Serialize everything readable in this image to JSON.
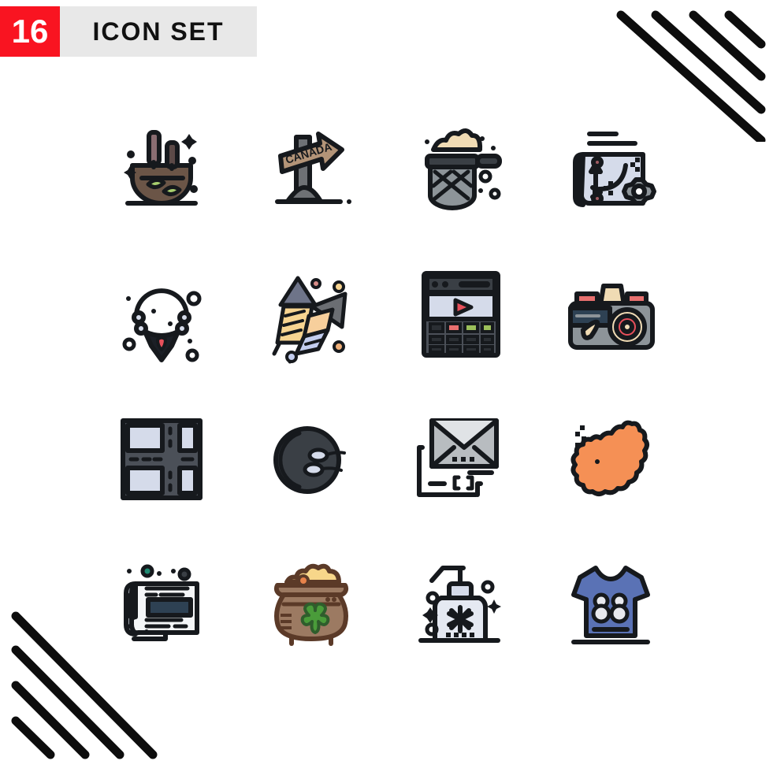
{
  "header": {
    "count": "16",
    "title": "ICON SET",
    "badge_color": "#f91421",
    "bar_color": "#e8e8e8",
    "title_color": "#111111"
  },
  "decor": {
    "top_right": {
      "name": "diagonal-stripes",
      "line_count": 4,
      "color": "#0d0d0d"
    },
    "bottom_left": {
      "name": "diagonal-stripes",
      "line_count": 4,
      "color": "#0d0d0d"
    }
  },
  "palette": {
    "outline": "#16191d",
    "brown": "#9c7a62",
    "brown_dark": "#6b5547",
    "green": "#8bc34a",
    "gray_blue": "#d5dbea",
    "gray": "#8d9499",
    "red": "#e8505b",
    "orange": "#f59055",
    "cream": "#f7e3b0",
    "blue": "#5a72b5",
    "dark": "#3a3f45"
  },
  "grid": {
    "columns": 4,
    "rows": 4,
    "total": 16
  },
  "icons": [
    {
      "index": 1,
      "name": "aroma-diffuser-icon",
      "label": "Aroma Diffuser",
      "row": 1,
      "col": 1
    },
    {
      "index": 2,
      "name": "canada-signpost-icon",
      "label": "Canada Signpost",
      "row": 1,
      "col": 2,
      "text": "CANADA"
    },
    {
      "index": 3,
      "name": "strainer-icon",
      "label": "Strainer",
      "row": 1,
      "col": 3
    },
    {
      "index": 4,
      "name": "strategy-plan-icon",
      "label": "Strategy Plan",
      "row": 1,
      "col": 4
    },
    {
      "index": 5,
      "name": "necklace-icon",
      "label": "Necklace",
      "row": 2,
      "col": 1
    },
    {
      "index": 6,
      "name": "fireworks-icon",
      "label": "Fireworks",
      "row": 2,
      "col": 2
    },
    {
      "index": 7,
      "name": "video-player-icon",
      "label": "Video Player",
      "row": 2,
      "col": 3
    },
    {
      "index": 8,
      "name": "camera-icon",
      "label": "Camera",
      "row": 2,
      "col": 4
    },
    {
      "index": 9,
      "name": "crossroad-icon",
      "label": "Crossroad",
      "row": 3,
      "col": 1
    },
    {
      "index": 10,
      "name": "fertilization-icon",
      "label": "Fertilization",
      "row": 3,
      "col": 2
    },
    {
      "index": 11,
      "name": "email-code-icon",
      "label": "Email Code",
      "row": 3,
      "col": 3
    },
    {
      "index": 12,
      "name": "ireland-map-icon",
      "label": "Ireland Map",
      "row": 3,
      "col": 4
    },
    {
      "index": 13,
      "name": "newspaper-icon",
      "label": "Newspaper",
      "row": 4,
      "col": 1
    },
    {
      "index": 14,
      "name": "pot-of-gold-icon",
      "label": "Pot Of Gold",
      "row": 4,
      "col": 2
    },
    {
      "index": 15,
      "name": "sanitizer-icon",
      "label": "Hand Sanitizer",
      "row": 4,
      "col": 3
    },
    {
      "index": 16,
      "name": "jersey-icon",
      "label": "Sports Jersey",
      "row": 4,
      "col": 4,
      "text": "88"
    }
  ]
}
